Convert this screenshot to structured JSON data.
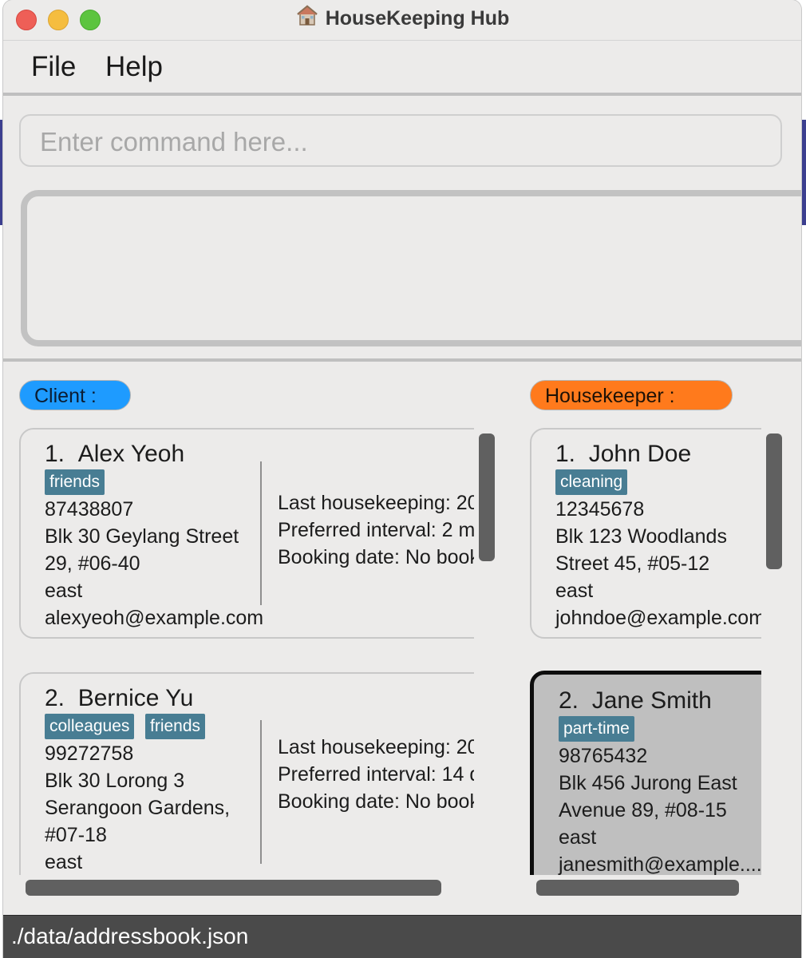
{
  "window": {
    "title": "HouseKeeping Hub",
    "title_icon": "house-icon"
  },
  "menu": {
    "file": "File",
    "help": "Help"
  },
  "command": {
    "placeholder": "Enter command here..."
  },
  "result": {
    "text": ""
  },
  "client_panel": {
    "label": "Client :",
    "color": "#1e9bff",
    "cards": [
      {
        "index": "1.",
        "name": "Alex Yeoh",
        "tags": [
          "friends"
        ],
        "phone": "87438807",
        "address_line1": "Blk 30 Geylang Street",
        "address_line2": "29, #06-40",
        "region": "east",
        "email": "alexyeoh@example.com",
        "last_housekeeping": "Last housekeeping: 20",
        "preferred_interval": "Preferred interval: 2 m...",
        "booking_date": "Booking date: No book"
      },
      {
        "index": "2.",
        "name": "Bernice Yu",
        "tags": [
          "colleagues",
          "friends"
        ],
        "phone": "99272758",
        "address_line1": "Blk 30 Lorong 3",
        "address_line2": "Serangoon Gardens,",
        "address_line3": "#07-18",
        "region": "east",
        "last_housekeeping": "Last housekeeping: 20",
        "preferred_interval": "Preferred interval: 14 d",
        "booking_date": "Booking date: No book"
      }
    ]
  },
  "housekeeper_panel": {
    "label": "Housekeeper :",
    "color": "#ff7a1c",
    "cards": [
      {
        "index": "1.",
        "name": "John Doe",
        "tags": [
          "cleaning"
        ],
        "phone": "12345678",
        "address_line1": "Blk 123 Woodlands",
        "address_line2": "Street 45, #05-12",
        "region": "east",
        "email": "johndoe@example.com"
      },
      {
        "index": "2.",
        "name": "Jane Smith",
        "tags": [
          "part-time"
        ],
        "phone": "98765432",
        "address_line1": "Blk 456 Jurong East",
        "address_line2": "Avenue 89, #08-15",
        "region": "east",
        "email": "janesmith@example....",
        "selected": true
      }
    ]
  },
  "status": {
    "path": "./data/addressbook.json"
  }
}
